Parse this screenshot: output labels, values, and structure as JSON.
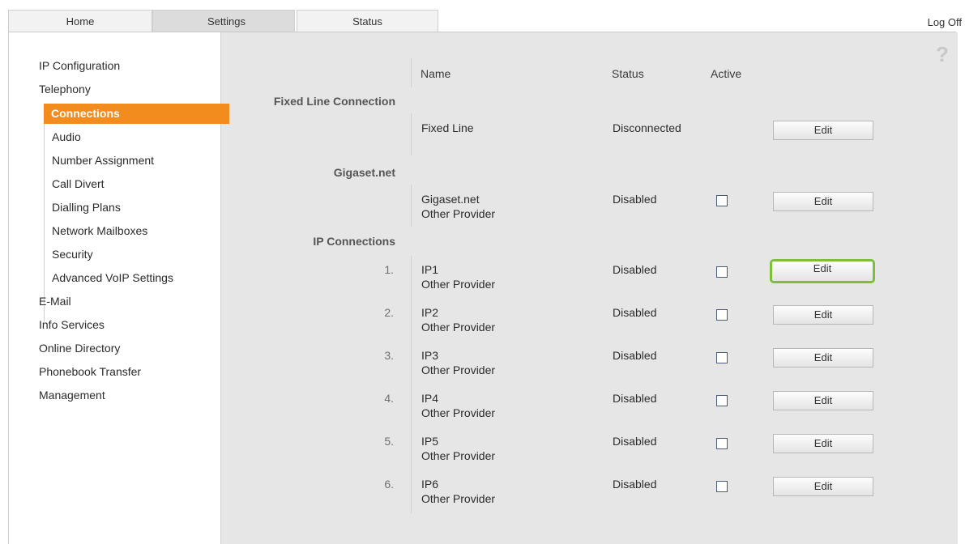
{
  "tabs": [
    {
      "label": "Home",
      "active": false
    },
    {
      "label": "Settings",
      "active": true
    },
    {
      "label": "Status",
      "active": false
    }
  ],
  "logoff": "Log Off",
  "help_icon": "?",
  "sidebar": {
    "items": [
      "IP Configuration",
      "Telephony",
      "E-Mail",
      "Info Services",
      "Online Directory",
      "Phonebook Transfer",
      "Management"
    ],
    "telephony_children": [
      "Connections",
      "Audio",
      "Number Assignment",
      "Call Divert",
      "Dialling Plans",
      "Network Mailboxes",
      "Security",
      "Advanced VoIP Settings"
    ],
    "active_item": "Connections",
    "active_color": "#f28c1e"
  },
  "table": {
    "headers": {
      "name": "Name",
      "status": "Status",
      "active": "Active"
    },
    "sections": {
      "fixed": "Fixed Line Connection",
      "gigaset": "Gigaset.net",
      "ip": "IP Connections"
    },
    "fixed_line": {
      "name": "Fixed Line",
      "status": "Disconnected",
      "edit": "Edit"
    },
    "gigaset_row": {
      "name": "Gigaset.net",
      "provider": "Other Provider",
      "status": "Disabled",
      "active": false,
      "edit": "Edit"
    },
    "ip_rows": [
      {
        "num": "1.",
        "name": "IP1",
        "provider": "Other Provider",
        "status": "Disabled",
        "active": false,
        "edit": "Edit"
      },
      {
        "num": "2.",
        "name": "IP2",
        "provider": "Other Provider",
        "status": "Disabled",
        "active": false,
        "edit": "Edit"
      },
      {
        "num": "3.",
        "name": "IP3",
        "provider": "Other Provider",
        "status": "Disabled",
        "active": false,
        "edit": "Edit"
      },
      {
        "num": "4.",
        "name": "IP4",
        "provider": "Other Provider",
        "status": "Disabled",
        "active": false,
        "edit": "Edit"
      },
      {
        "num": "5.",
        "name": "IP5",
        "provider": "Other Provider",
        "status": "Disabled",
        "active": false,
        "edit": "Edit"
      },
      {
        "num": "6.",
        "name": "IP6",
        "provider": "Other Provider",
        "status": "Disabled",
        "active": false,
        "edit": "Edit"
      }
    ],
    "highlight_color": "#7fbe3d"
  }
}
